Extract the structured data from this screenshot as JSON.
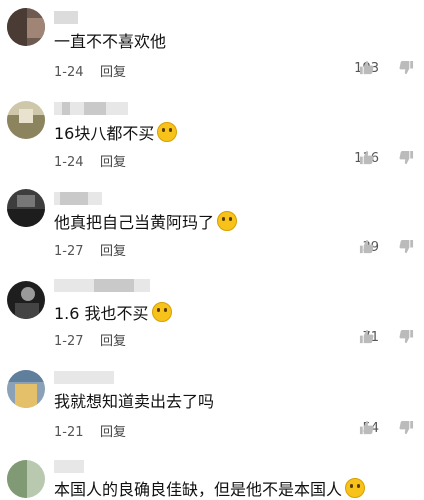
{
  "comments": [
    {
      "text": "一直不不喜欢他",
      "date": "1-24",
      "reply": "回复",
      "likes": "193",
      "emoji": ""
    },
    {
      "text": "16块八都不买",
      "date": "1-24",
      "reply": "回复",
      "likes": "116",
      "emoji": "grinning-squint-emoji"
    },
    {
      "text": "他真把自己当黄阿玛了",
      "date": "1-27",
      "reply": "回复",
      "likes": "39",
      "emoji": "grinning-squint-emoji"
    },
    {
      "text": "1.6 我也不买",
      "date": "1-27",
      "reply": "回复",
      "likes": "71",
      "emoji": "smirk-emoji"
    },
    {
      "text": "我就想知道卖出去了吗",
      "date": "1-21",
      "reply": "回复",
      "likes": "54",
      "emoji": ""
    },
    {
      "text": "本国人的良确良佳缺，但是他不是本国人",
      "date": "",
      "reply": "",
      "likes": "",
      "emoji": "smile-emoji"
    }
  ],
  "icons": {
    "like": "thumbs-up-icon",
    "dislike": "thumbs-down-icon"
  },
  "colors": {
    "meta_text": "#555555",
    "icon": "#bbbbbb",
    "emoji": "#f7c21a"
  }
}
